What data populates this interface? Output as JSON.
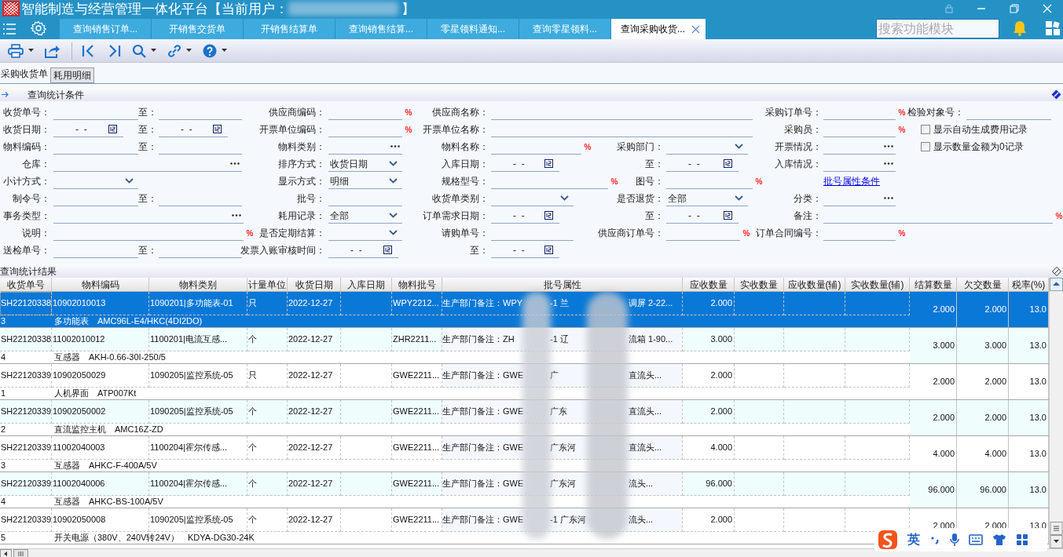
{
  "window": {
    "title": "智能制造与经营管理一体化平台【当前用户：",
    "title_end": "】"
  },
  "tabs": [
    {
      "label": "查询销售订单...",
      "selected": false
    },
    {
      "label": "开销售交货单",
      "selected": false
    },
    {
      "label": "开销售结算单",
      "selected": false
    },
    {
      "label": "查询销售结算...",
      "selected": false
    },
    {
      "label": "零星领料通知...",
      "selected": false
    },
    {
      "label": "查询零星领料...",
      "selected": false
    },
    {
      "label": "查询采购收货...",
      "selected": true
    }
  ],
  "search": {
    "placeholder": "搜索功能模块"
  },
  "sub_tabs": [
    {
      "label": "采购收货单",
      "selected": true
    },
    {
      "label": "耗用明细",
      "selected": false
    }
  ],
  "conditions": {
    "title": "查询统计条件",
    "rows": [
      [
        {
          "kind": "text",
          "label": "收货单号："
        },
        {
          "kind": "text",
          "label": "至："
        },
        {
          "kind": "text",
          "label": "供应商编码：",
          "fuzzy_mark": "%"
        },
        {
          "kind": "text",
          "label": "供应商名称："
        },
        {
          "kind": "text",
          "label": "采购订单号：",
          "fuzzy_mark": "%"
        },
        {
          "kind": "text",
          "label": "检验对象号："
        }
      ],
      [
        {
          "kind": "date",
          "label": "收货日期：",
          "value": "-  -"
        },
        {
          "kind": "date",
          "label": "至：",
          "value": "-  -"
        },
        {
          "kind": "text",
          "label": "开票单位编码：",
          "fuzzy_mark": "%"
        },
        {
          "kind": "text",
          "label": "开票单位名称："
        },
        {
          "kind": "text",
          "label": "采购员：",
          "fuzzy_mark": "%"
        },
        {
          "kind": "checkbox",
          "label": "显示自动生成费用记录",
          "checked": false
        }
      ],
      [
        {
          "kind": "text",
          "label": "物料编码："
        },
        {
          "kind": "text",
          "label": "至："
        },
        {
          "kind": "lookup",
          "label": "物料类别："
        },
        {
          "kind": "text",
          "label": "物料名称：",
          "fuzzy_mark": "%"
        },
        {
          "kind": "select",
          "label": "采购部门："
        },
        {
          "kind": "lookup",
          "label": "开票情况："
        },
        {
          "kind": "checkbox",
          "label": "显示数量金额为0记录",
          "checked": false
        }
      ],
      [
        {
          "kind": "lookup",
          "label": "仓库："
        },
        {
          "kind": "select",
          "label": "排序方式：",
          "value": "收货日期"
        },
        {
          "kind": "date",
          "label": "入库日期：",
          "value": "-  -"
        },
        {
          "kind": "date",
          "label": "至：",
          "value": "-  -"
        },
        {
          "kind": "lookup",
          "label": "入库情况："
        }
      ],
      [
        {
          "kind": "select",
          "label": "小计方式："
        },
        {
          "kind": "select",
          "label": "显示方式：",
          "value": "明细"
        },
        {
          "kind": "text",
          "label": "规格型号：",
          "fuzzy_mark": "%"
        },
        {
          "kind": "text",
          "label": "图号：",
          "fuzzy_mark": "%"
        },
        {
          "kind": "link",
          "label": "批号属性条件"
        }
      ],
      [
        {
          "kind": "text",
          "label": "制令号："
        },
        {
          "kind": "text",
          "label": "至："
        },
        {
          "kind": "text",
          "label": "批号："
        },
        {
          "kind": "select",
          "label": "收货单类别："
        },
        {
          "kind": "select",
          "label": "是否退货：",
          "value": "全部"
        },
        {
          "kind": "lookup",
          "label": "分类："
        }
      ],
      [
        {
          "kind": "lookup",
          "label": "事务类型："
        },
        {
          "kind": "select",
          "label": "耗用记录：",
          "value": "全部"
        },
        {
          "kind": "date",
          "label": "订单需求日期：",
          "value": "-  -"
        },
        {
          "kind": "date",
          "label": "至：",
          "value": "-  -"
        },
        {
          "kind": "text",
          "label": "备注：",
          "fuzzy_mark": "%"
        }
      ],
      [
        {
          "kind": "text",
          "label": "说明：",
          "fuzzy_mark": "%"
        },
        {
          "kind": "select",
          "label": "是否定期结算："
        },
        {
          "kind": "text",
          "label": "请购单号："
        },
        {
          "kind": "text",
          "label": "供应商订单号：",
          "fuzzy_mark": "%"
        },
        {
          "kind": "text",
          "label": "订单合同编号：",
          "fuzzy_mark": "%"
        }
      ],
      [
        {
          "kind": "text",
          "label": "送检单号："
        },
        {
          "kind": "text",
          "label": "至："
        },
        {
          "kind": "date",
          "label": "发票入账审核时间：",
          "value": "-  -"
        },
        {
          "kind": "date",
          "label": "至：",
          "value": "-  -"
        }
      ]
    ]
  },
  "results": {
    "title": "查询统计结果",
    "columns": [
      "收货单号",
      "物料编码",
      "物料类别",
      "计量单位",
      "收货日期",
      "入库日期",
      "物料批号",
      "批号属性",
      "应收数量",
      "实收数量",
      "应收数量(辅)",
      "实收数量(辅)",
      "结算数量",
      "欠交数量",
      "税率(%)"
    ],
    "rows": [
      {
        "selected": true,
        "receipt_no": "SH22120338",
        "material_code": "10902010013",
        "category": "1090201|多功能表-01",
        "unit": "只",
        "date": "2022-12-27",
        "batch_no": "WPY2212...",
        "attr": [
          "生产部门备注：WPY",
          "-1 兰",
          "调屏 2-22..."
        ],
        "qty_due": "2.000",
        "settled": "2.000",
        "owed": "2.000",
        "tax": "13.0",
        "line_no": "3",
        "item": "多功能表　AMC96L-E4/HKC(4DI2DO)"
      },
      {
        "selected": false,
        "receipt_no": "SH22120338",
        "material_code": "11002010012",
        "category": "1100201|电流互感...",
        "unit": "个",
        "date": "2022-12-27",
        "batch_no": "ZHR2211...",
        "attr": [
          "生产部门备注：ZH",
          "-1 辽",
          "流箱 1-90..."
        ],
        "qty_due": "3.000",
        "settled": "3.000",
        "owed": "3.000",
        "tax": "13.0",
        "line_no": "4",
        "item": "互感器　AKH-0.66-30I-250/5"
      },
      {
        "selected": false,
        "receipt_no": "SH22120339",
        "material_code": "10902050029",
        "category": "1090205|监控系统-05",
        "unit": "只",
        "date": "2022-12-27",
        "batch_no": "GWE2211...",
        "attr": [
          "生产部门备注：GWE",
          "广",
          "直流头..."
        ],
        "qty_due": "2.000",
        "settled": "2.000",
        "owed": "2.000",
        "tax": "13.0",
        "line_no": "1",
        "item": "人机界面　ATP007Kt"
      },
      {
        "selected": false,
        "receipt_no": "SH22120339",
        "material_code": "10902050002",
        "category": "1090205|监控系统-05",
        "unit": "个",
        "date": "2022-12-27",
        "batch_no": "GWE2211...",
        "attr": [
          "生产部门备注：GWE",
          "广东",
          "直流头..."
        ],
        "qty_due": "2.000",
        "settled": "2.000",
        "owed": "2.000",
        "tax": "13.0",
        "line_no": "2",
        "item": "直流监控主机　AMC16Z-ZD"
      },
      {
        "selected": false,
        "receipt_no": "SH22120339",
        "material_code": "11002040003",
        "category": "1100204|霍尔传感...",
        "unit": "个",
        "date": "2022-12-27",
        "batch_no": "GWE2211...",
        "attr": [
          "生产部门备注：GWE",
          "广东河",
          "直流头..."
        ],
        "qty_due": "4.000",
        "settled": "4.000",
        "owed": "4.000",
        "tax": "13.0",
        "line_no": "3",
        "item": "互感器　AHKC-F-400A/5V"
      },
      {
        "selected": false,
        "receipt_no": "SH22120339",
        "material_code": "11002040006",
        "category": "1100204|霍尔传感...",
        "unit": "个",
        "date": "2022-12-27",
        "batch_no": "GWE2211...",
        "attr": [
          "生产部门备注：GWE",
          "广东河",
          "流头..."
        ],
        "qty_due": "96.000",
        "settled": "96.000",
        "owed": "96.000",
        "tax": "13.0",
        "line_no": "4",
        "item": "互感器　AHKC-BS-100A/5V"
      },
      {
        "selected": false,
        "receipt_no": "SH22120339",
        "material_code": "10902050008",
        "category": "1090205|监控系统-05",
        "unit": "个",
        "date": "2022-12-27",
        "batch_no": "GWE2211...",
        "attr": [
          "生产部门备注：GWE",
          "-1 广东河",
          "流头..."
        ],
        "qty_due": "2.000",
        "settled": "2.000",
        "owed": "2.000",
        "tax": "13.0",
        "line_no": "5",
        "item": "开关电源（380V、240V转24V）　KDYA-DG30-24K"
      }
    ]
  },
  "ime_bar": {
    "mode": "英"
  }
}
